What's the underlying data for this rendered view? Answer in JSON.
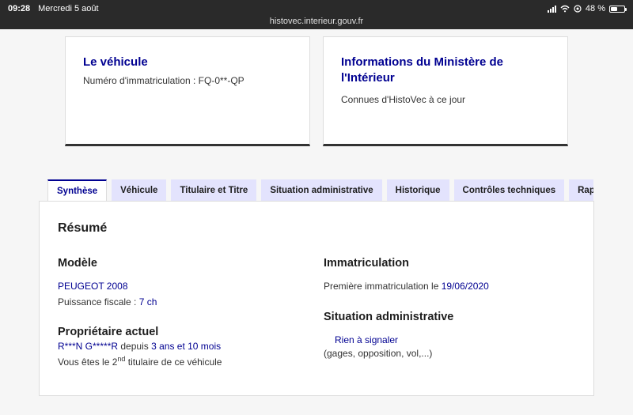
{
  "statusbar": {
    "time": "09:28",
    "date": "Mercredi 5 août",
    "battery": "48 %",
    "battery_level": 0.48
  },
  "browser": {
    "url": "histovec.interieur.gouv.fr"
  },
  "cards": {
    "vehicle": {
      "title": "Le véhicule",
      "text": "Numéro d'immatriculation : FQ-0**-QP"
    },
    "ministry": {
      "title": "Informations du Ministère de l'Intérieur",
      "text": "Connues d'HistoVec à ce jour"
    }
  },
  "tabs": [
    {
      "label": "Synthèse",
      "active": true
    },
    {
      "label": "Véhicule"
    },
    {
      "label": "Titulaire et Titre"
    },
    {
      "label": "Situation administrative"
    },
    {
      "label": "Historique"
    },
    {
      "label": "Contrôles techniques"
    },
    {
      "label": "Rap"
    }
  ],
  "summary": {
    "heading": "Résumé",
    "model": {
      "heading": "Modèle",
      "name": "PEUGEOT 2008",
      "power_label": "Puissance fiscale :",
      "power_value": "7 ch"
    },
    "owner": {
      "heading": "Propriétaire actuel",
      "name": "R***N G*****R",
      "since_label": "depuis",
      "since_value": "3 ans et 10 mois",
      "rank_prefix": "Vous êtes le 2",
      "rank_sup": "nd",
      "rank_suffix": "titulaire de ce véhicule"
    },
    "registration": {
      "heading": "Immatriculation",
      "first_label": "Première immatriculation le",
      "first_date": "19/06/2020"
    },
    "admin": {
      "heading": "Situation administrative",
      "status": "Rien à signaler",
      "note": "(gages, opposition, vol,...)"
    }
  }
}
